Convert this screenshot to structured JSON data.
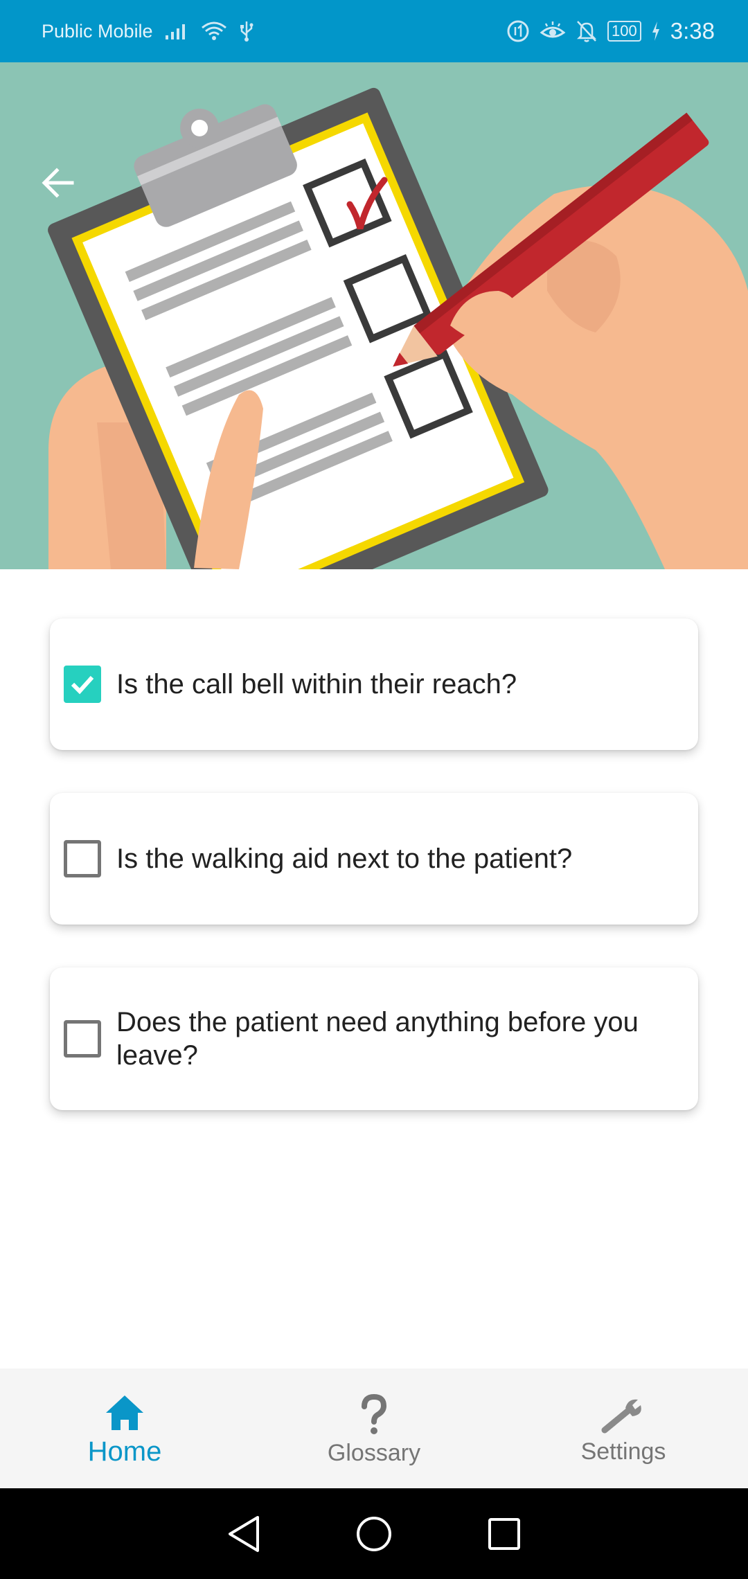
{
  "status_bar": {
    "carrier": "Public Mobile",
    "battery": "100",
    "time": "3:38",
    "icons": [
      "signal-icon",
      "wifi-icon",
      "usb-icon",
      "data-saver-icon",
      "eye-comfort-icon",
      "bell-off-icon",
      "battery-icon",
      "charging-icon"
    ]
  },
  "header": {
    "back_icon": "arrow-left-icon",
    "illustration": "clipboard-checklist-illustration"
  },
  "checklist": {
    "items": [
      {
        "label": "Is the call bell within their reach?",
        "checked": true
      },
      {
        "label": "Is the walking aid next to the patient?",
        "checked": false
      },
      {
        "label": "Does the patient need anything before you leave?",
        "checked": false
      }
    ]
  },
  "bottom_nav": {
    "items": [
      {
        "label": "Home",
        "icon": "home-icon",
        "active": true
      },
      {
        "label": "Glossary",
        "icon": "question-mark-icon",
        "active": false
      },
      {
        "label": "Settings",
        "icon": "wrench-icon",
        "active": false
      }
    ]
  },
  "colors": {
    "status_bar": "#0296c9",
    "accent": "#0a96c8",
    "checkbox_checked": "#26d0bf",
    "hero_background": "#8bc4b4"
  }
}
